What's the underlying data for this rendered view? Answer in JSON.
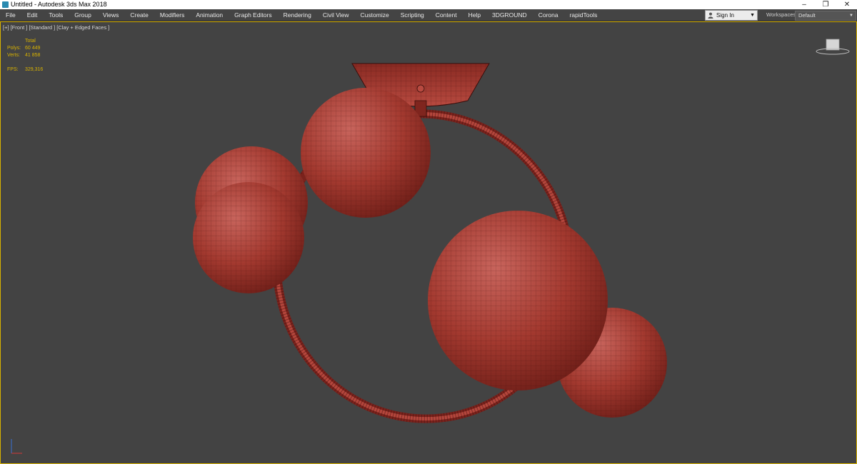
{
  "window": {
    "title": "Untitled - Autodesk 3ds Max 2018",
    "controls": {
      "minimize": "–",
      "restore": "❐",
      "close": "✕"
    }
  },
  "menu": {
    "items": [
      "File",
      "Edit",
      "Tools",
      "Group",
      "Views",
      "Create",
      "Modifiers",
      "Animation",
      "Graph Editors",
      "Rendering",
      "Civil View",
      "Customize",
      "Scripting",
      "Content",
      "Help",
      "3DGROUND",
      "Corona",
      "rapidTools"
    ]
  },
  "signin": {
    "label": "Sign In"
  },
  "workspaces": {
    "label": "Workspaces:",
    "value": "Default"
  },
  "viewport": {
    "label": "[+] [Front ] [Standard ] [Clay + Edged Faces ]",
    "stats": {
      "header": "Total",
      "polys_label": "Polys:",
      "polys_value": "60 449",
      "verts_label": "Verts:",
      "verts_value": "41 858",
      "fps_label": "FPS:",
      "fps_value": "329,316"
    }
  },
  "colors": {
    "viewport_bg": "#434343",
    "active_border": "#d8b200",
    "clay": "#a8403a",
    "stats_text": "#d8b200"
  },
  "icons": {
    "app": "app-icon",
    "user": "user-icon",
    "viewcube": "viewcube-icon",
    "axis": "axis-gizmo-icon"
  }
}
